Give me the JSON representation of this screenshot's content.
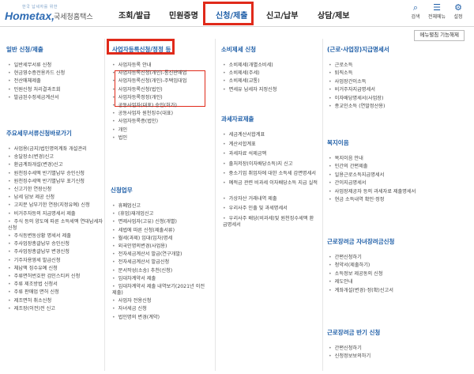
{
  "header": {
    "logo_sub": "한국 납세자를 위한",
    "logo_main": "Hometax,",
    "logo_kr": "국세청홈택스",
    "nav": [
      "조회/발급",
      "민원증명",
      "신청/제출",
      "신고/납부",
      "상담/제보"
    ],
    "icons": [
      {
        "icon": "search-icon",
        "glyph": "⌕",
        "label": "검색"
      },
      {
        "icon": "menu-icon",
        "glyph": "☰",
        "label": "전체메뉴"
      },
      {
        "icon": "gear-icon",
        "glyph": "⚙",
        "label": "설정"
      }
    ]
  },
  "settings_button": "메뉴펼침 기능해제",
  "columns": [
    {
      "sections": [
        {
          "title": "일반 신청/제출",
          "items": [
            "일반세무서류 신청",
            "현금영수증전용카드 신청",
            "전산매체제출",
            "민원신청 처리결과조회",
            "발급된수정세금계산서"
          ]
        },
        {
          "title": "주요세무서류신청바로가기",
          "items": [
            "사업용(금지)법인명의계좌 개설관리",
            "송달장소(변경)신고",
            "환급계좌개설(변경)신고",
            "원천징수세액 반기별납부 승인신청",
            "원천징수세액 반기별납부 포기신청",
            "신고기한 연장신청",
            "납세 담보 제공 신청",
            "고지분 납부기한 연장(지정유예) 신청",
            "비거주자등의 지급명세서 제출",
            "주식 등의 양도에 따른 소득세액 연대납세자 신청",
            "주식등변동상황 명세서 제출",
            "주사업장총괄납부 승인신청",
            "주사업장총괄납부 변경신청",
            "기주자용영세 발급신청",
            "체납액 징수유예 신청",
            "주류면허번호판 검인스티커 신청",
            "주류 제조방법 신청서",
            "주류 판매업 면허 신청",
            "제조면허 취소신청",
            "제조장(이전)전 신고"
          ]
        }
      ]
    },
    {
      "sections": [
        {
          "title": "사업자등록신청/정정 등",
          "items": [
            "사업자등록 안내",
            "사업자등록신청(개인)-통신판매업",
            "사업자등록신청(개인)-주택임대업",
            "사업자등록신청(법인)",
            "사업자등록정정(개인)",
            "공동사업자(대표) 승인(허가)",
            "공동사업자 원천징수(대표)",
            "사업자등록증(법인)",
            "개인",
            "법인"
          ]
        },
        {
          "title": "신청업무",
          "items": [
            "휴폐업신고",
            "(휴업)재개업신고",
            "면제사업자(고유) 신청(개별)",
            "세법에 따른 신청(제출서류)",
            "월세(과제) 임대(임차)명세",
            "외국인명의변경(사업용)",
            "전자세금계산서 발급(연구개발)",
            "전자세금계산서 발급신청",
            "문서작성(소송) 추천(신청)",
            "임대차계약서 제출",
            "임대차계약서 제출 내역보기(2021년 이전 제출)",
            "사업자 전용신청",
            "자녀세금 신청",
            "법인명의 변경(계약)"
          ]
        }
      ]
    },
    {
      "sections": [
        {
          "title": "소비제세 신청",
          "items": [
            "소비제세(개별소비세)",
            "소비제세(주세)",
            "소비제세(교통)",
            "면세유 납세자 지정신청"
          ]
        },
        {
          "title": "과세자료제출",
          "items": [
            "세금계산서합계표",
            "계산서합계표",
            "과세자료 석제금액",
            "출처저장(이자배당소득)지 신고",
            "중소기업 취업자에 대한 소득세 감면명세서",
            "예적금 관련 비과세 이자배당소득 지급 실적",
            "가상자산 거래내역 제출",
            "우리사주 인출 및 과세명세서",
            "우리사주 배당(비과세)및 원천징수세액 환급명세서"
          ]
        }
      ]
    },
    {
      "sections": [
        {
          "title": "(근로·사업장)지급명세서",
          "items": [
            "근로소득",
            "퇴직소득",
            "사업장간이소득",
            "비거주자지급명세서",
            "이자배당명세서(사업장)",
            "종교인소득 (연말정산용)"
          ]
        },
        {
          "title": "복지이음",
          "items": [
            "복지이음 안내",
            "민간의 간편제출",
            "일용근로소득지급명세서",
            "간이지급명세서",
            "사업장제공자 등의 과세자료 제출명세서",
            "현금 소득내역 확인·정정"
          ]
        },
        {
          "title": "근로장려금 자녀장려금신청",
          "items": [
            "간편신청하기",
            "청약서(제출하기)",
            "소득정보 제공동의 신청",
            "제도안내",
            "계좌개설(변경)·정(확)신고서"
          ]
        },
        {
          "title": "근로장려금 반기 신청",
          "items": [
            "간편신청하기",
            "신청정보보의하기"
          ]
        }
      ]
    }
  ]
}
